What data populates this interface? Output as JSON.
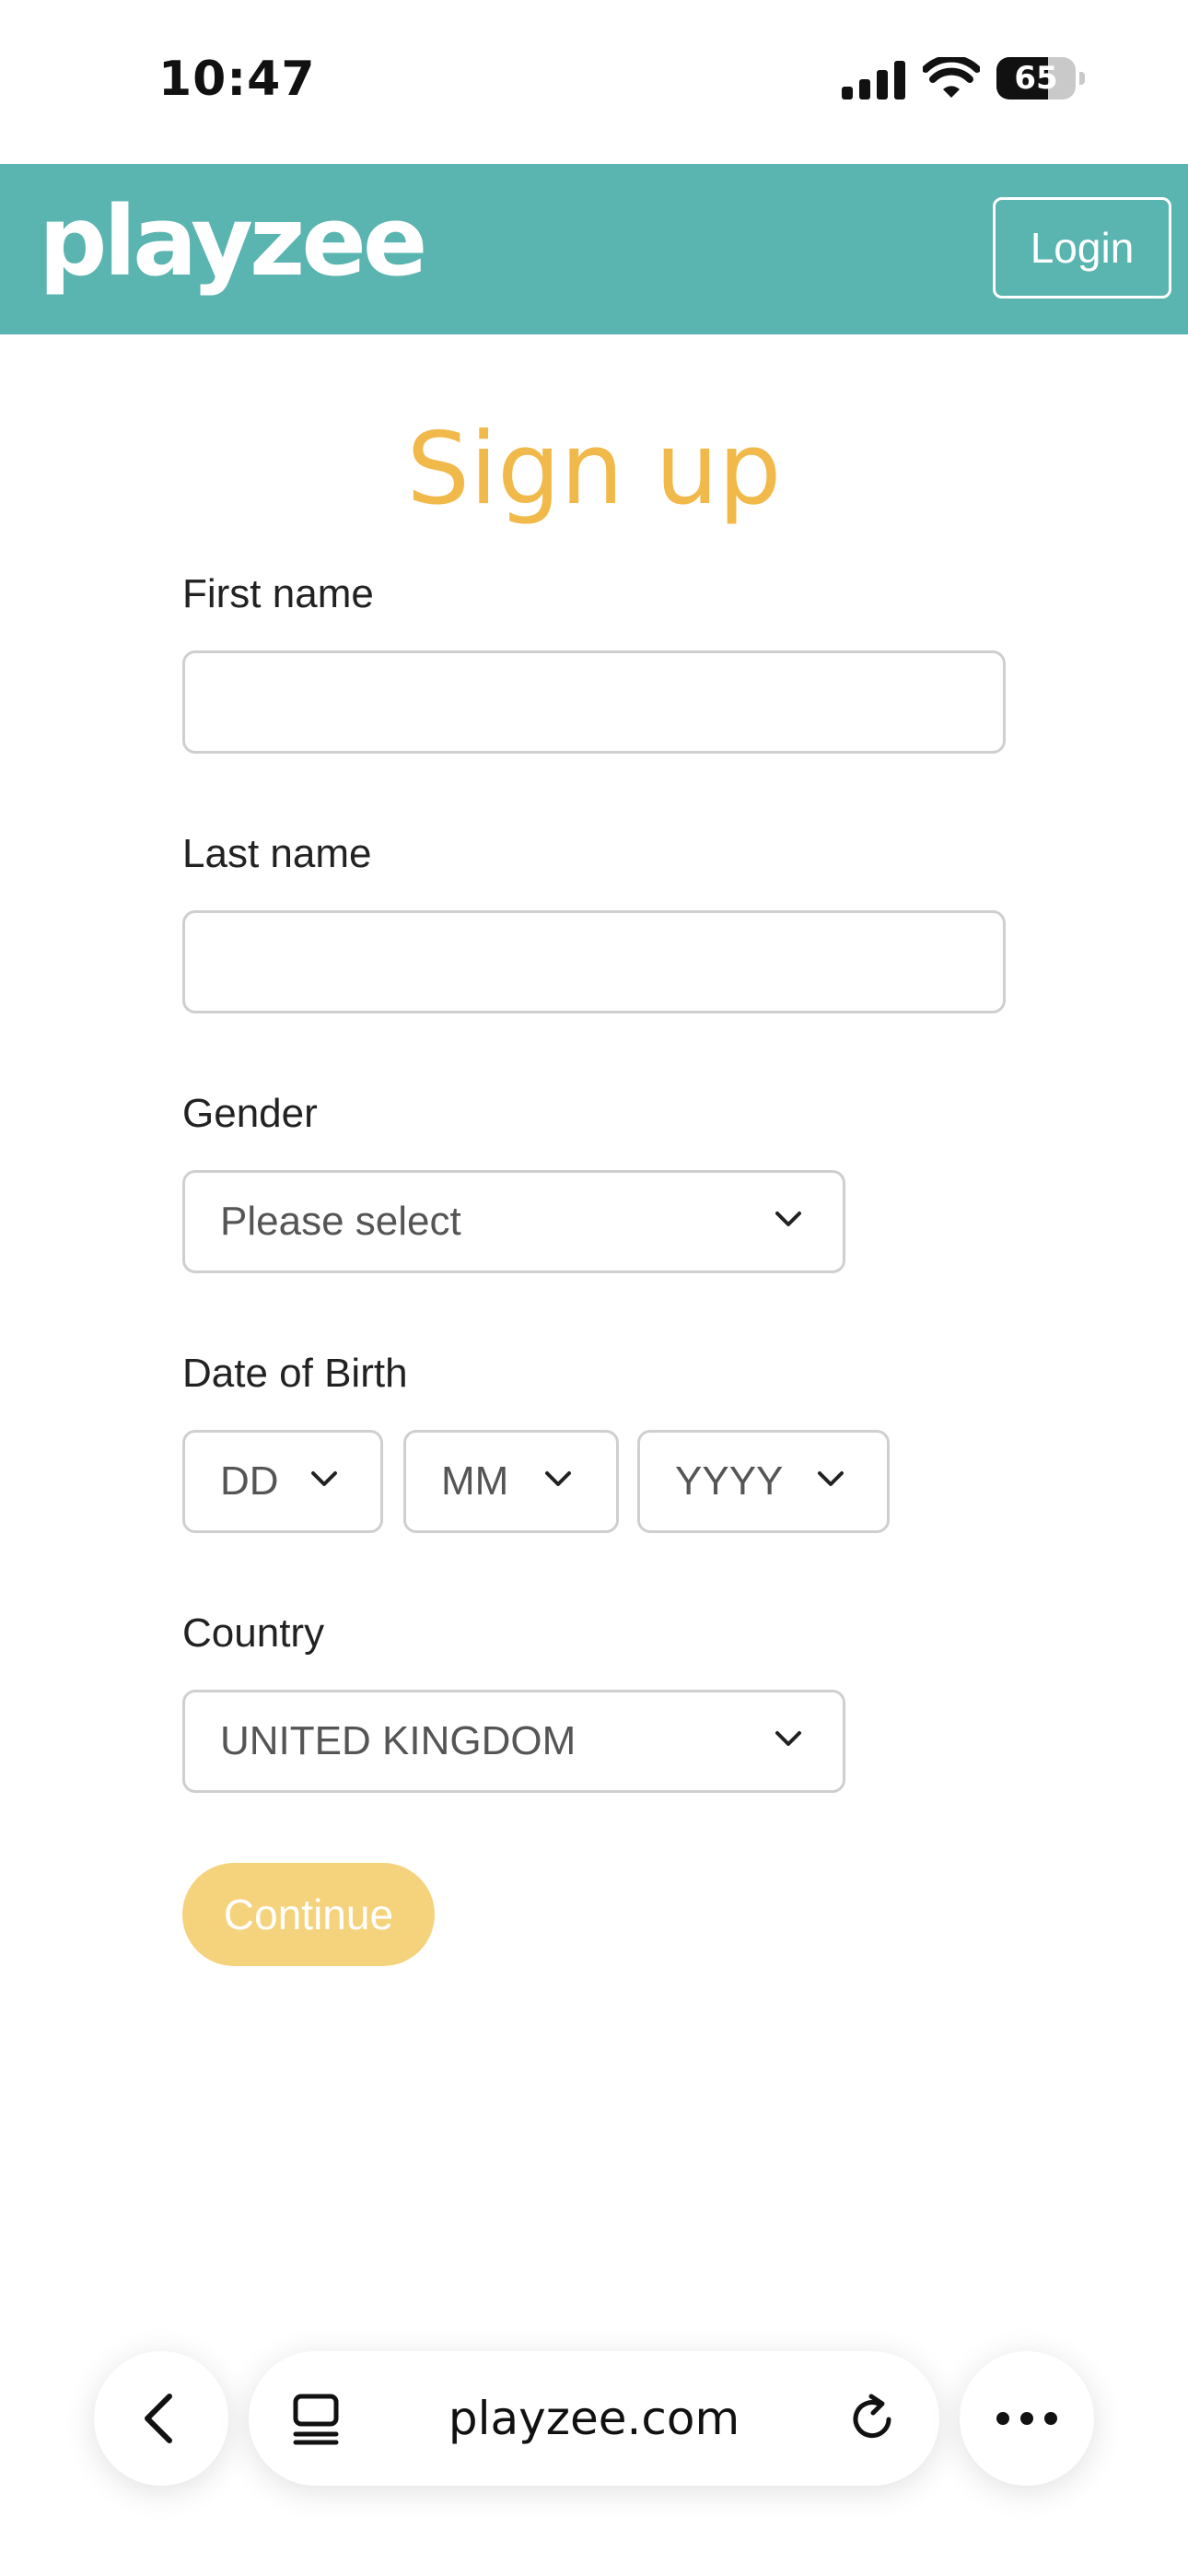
{
  "status_bar": {
    "time": "10:47",
    "battery_level": "65",
    "battery_fraction": 0.65
  },
  "header": {
    "logo": "playzee",
    "login_label": "Login",
    "brand_color": "#5ab4b0"
  },
  "form": {
    "title": "Sign up",
    "first_name": {
      "label": "First name",
      "value": ""
    },
    "last_name": {
      "label": "Last name",
      "value": ""
    },
    "gender": {
      "label": "Gender",
      "selected": "Please select"
    },
    "dob": {
      "label": "Date of Birth",
      "day": "DD",
      "month": "MM",
      "year": "YYYY"
    },
    "country": {
      "label": "Country",
      "selected": "UNITED KINGDOM"
    },
    "continue_label": "Continue",
    "accent_color": "#f0b94a"
  },
  "browser_bar": {
    "url": "playzee.com"
  },
  "icons": {
    "signal": "cellular-signal-icon",
    "wifi": "wifi-icon",
    "battery": "battery-icon",
    "dropdown": "chevron-down-icon",
    "back": "chevron-left-icon",
    "tabs": "tabs-icon",
    "reload": "reload-icon",
    "more": "more-dots-icon"
  }
}
